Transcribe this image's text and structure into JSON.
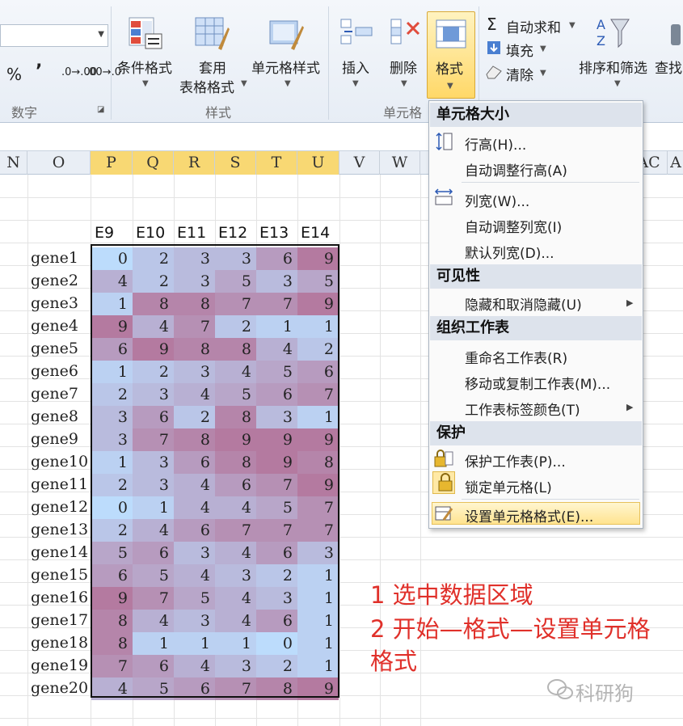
{
  "ribbon": {
    "percent": "%",
    "comma": "’",
    "dec_inc": ".0→.00",
    "dec_dec": ".00→.0",
    "group_number": "数字",
    "cond_format": "条件格式",
    "apply_table_1": "套用",
    "apply_table_2": "表格格式",
    "cell_style": "单元格样式",
    "group_style": "样式",
    "insert": "插入",
    "delete": "删除",
    "format": "格式",
    "group_cells": "单元格",
    "autosum": "自动求和",
    "fill": "填充",
    "clear": "清除",
    "sort_filter": "排序和筛选",
    "find": "查找"
  },
  "columns": [
    "N",
    "O",
    "P",
    "Q",
    "R",
    "S",
    "T",
    "U",
    "V",
    "W",
    "AC",
    "A"
  ],
  "sheet": {
    "headers": [
      "E9",
      "E10",
      "E11",
      "E12",
      "E13",
      "E14"
    ],
    "rows": [
      {
        "gene": "gene1",
        "values": [
          0,
          2,
          3,
          3,
          6,
          9
        ]
      },
      {
        "gene": "gene2",
        "values": [
          4,
          2,
          3,
          5,
          3,
          5
        ]
      },
      {
        "gene": "gene3",
        "values": [
          1,
          8,
          8,
          7,
          7,
          9
        ]
      },
      {
        "gene": "gene4",
        "values": [
          9,
          4,
          7,
          2,
          1,
          1
        ]
      },
      {
        "gene": "gene5",
        "values": [
          6,
          9,
          8,
          8,
          4,
          2
        ]
      },
      {
        "gene": "gene6",
        "values": [
          1,
          2,
          3,
          4,
          5,
          6
        ]
      },
      {
        "gene": "gene7",
        "values": [
          2,
          3,
          4,
          5,
          6,
          7
        ]
      },
      {
        "gene": "gene8",
        "values": [
          3,
          6,
          2,
          8,
          3,
          1
        ]
      },
      {
        "gene": "gene9",
        "values": [
          3,
          7,
          8,
          9,
          9,
          9
        ]
      },
      {
        "gene": "gene10",
        "values": [
          1,
          3,
          6,
          8,
          9,
          8
        ]
      },
      {
        "gene": "gene11",
        "values": [
          2,
          3,
          4,
          6,
          7,
          9
        ]
      },
      {
        "gene": "gene12",
        "values": [
          0,
          1,
          4,
          4,
          5,
          7
        ]
      },
      {
        "gene": "gene13",
        "values": [
          2,
          4,
          6,
          7,
          7,
          7
        ]
      },
      {
        "gene": "gene14",
        "values": [
          5,
          6,
          3,
          4,
          6,
          3
        ]
      },
      {
        "gene": "gene15",
        "values": [
          6,
          5,
          4,
          3,
          2,
          1
        ]
      },
      {
        "gene": "gene16",
        "values": [
          9,
          7,
          5,
          4,
          3,
          1
        ]
      },
      {
        "gene": "gene17",
        "values": [
          8,
          4,
          3,
          4,
          6,
          1
        ]
      },
      {
        "gene": "gene18",
        "values": [
          8,
          1,
          1,
          1,
          0,
          1
        ]
      },
      {
        "gene": "gene19",
        "values": [
          7,
          6,
          4,
          3,
          2,
          1
        ]
      },
      {
        "gene": "gene20",
        "values": [
          4,
          5,
          6,
          7,
          8,
          9
        ]
      }
    ],
    "color_low": "#bcdcfc",
    "color_high": "#b47aa0"
  },
  "menu": {
    "sec_size": "单元格大小",
    "row_height": "行高(H)...",
    "autofit_row": "自动调整行高(A)",
    "col_width": "列宽(W)...",
    "autofit_col": "自动调整列宽(I)",
    "default_width": "默认列宽(D)...",
    "sec_visibility": "可见性",
    "hide_unhide": "隐藏和取消隐藏(U)",
    "sec_organize": "组织工作表",
    "rename": "重命名工作表(R)",
    "move_copy": "移动或复制工作表(M)...",
    "tab_color": "工作表标签颜色(T)",
    "sec_protect": "保护",
    "protect_sheet": "保护工作表(P)...",
    "lock_cell": "锁定单元格(L)",
    "format_cells": "设置单元格格式(E)..."
  },
  "annotation": {
    "line1": "1 选中数据区域",
    "line2": "2 开始—格式—设置单元格",
    "line3": "格式"
  },
  "watermark": "科研狗"
}
